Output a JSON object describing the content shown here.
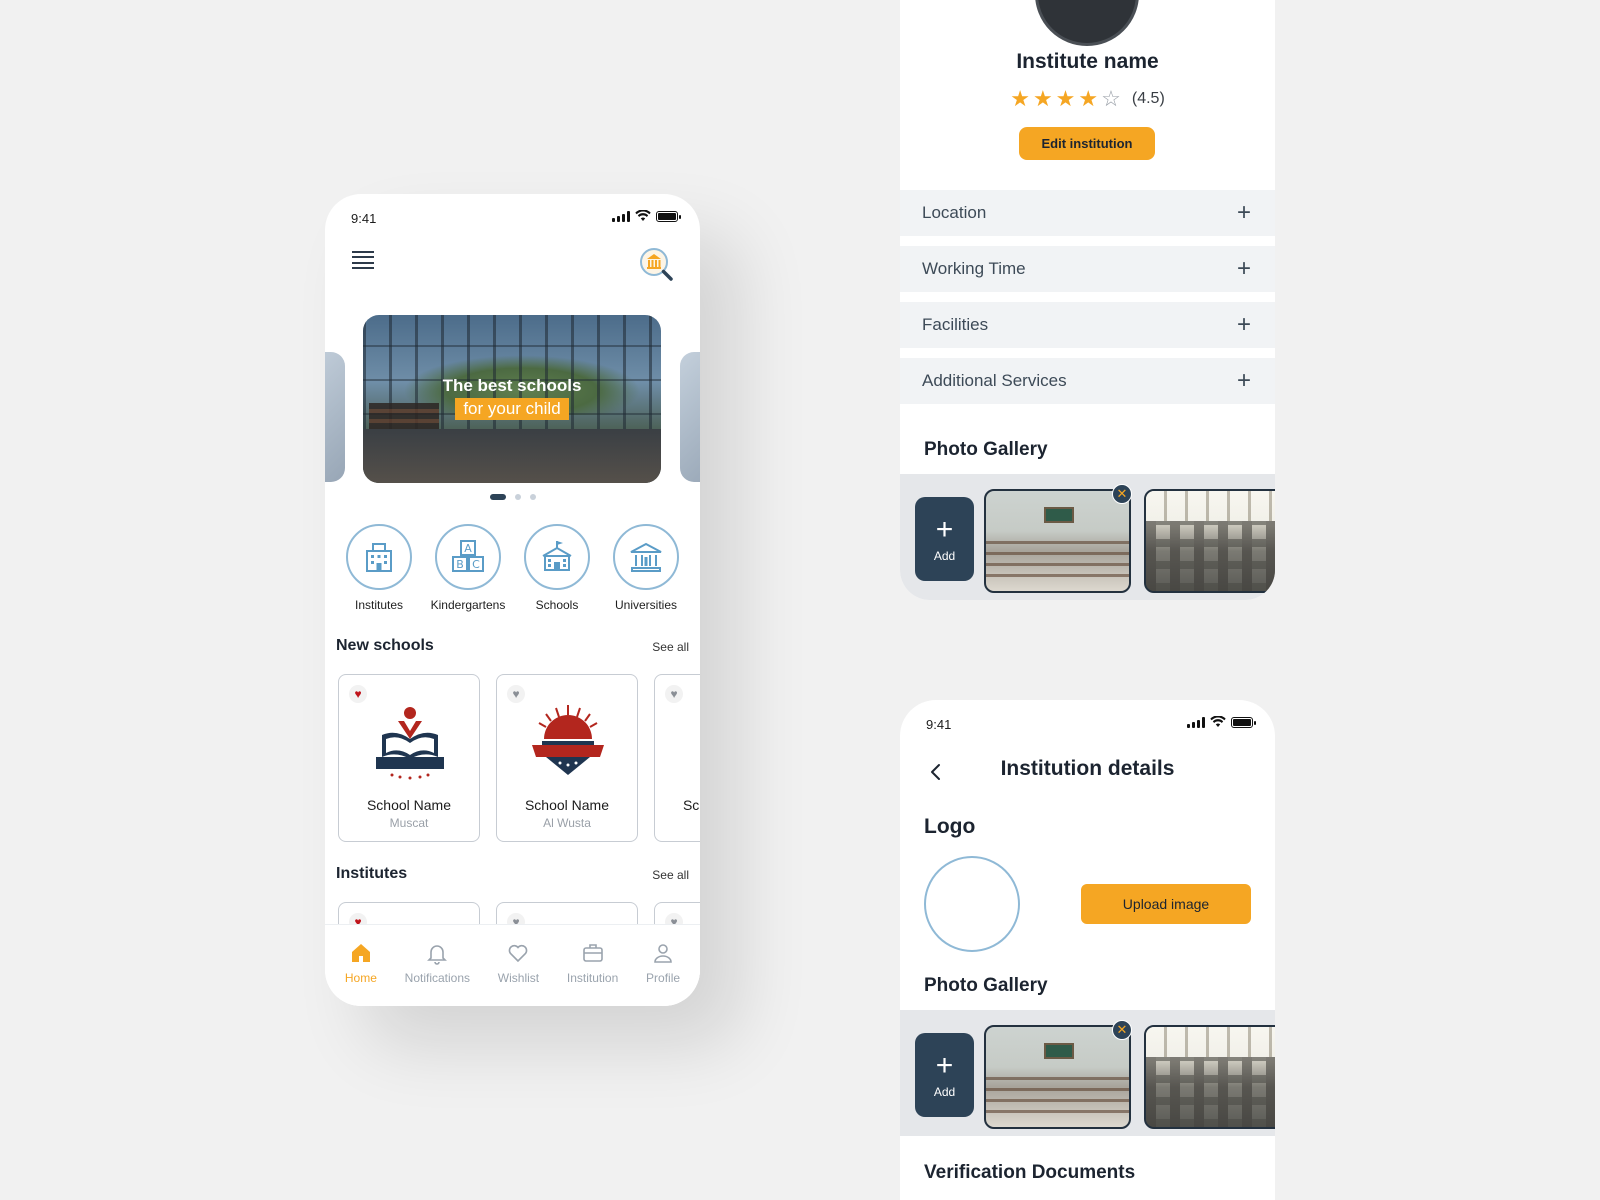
{
  "home": {
    "status_time": "9:41",
    "banner": {
      "line1": "The best schools",
      "line2": "for your child"
    },
    "categories": [
      {
        "label": "Institutes",
        "icon": "building-icon"
      },
      {
        "label": "Kindergartens",
        "icon": "abc-blocks-icon"
      },
      {
        "label": "Schools",
        "icon": "school-icon"
      },
      {
        "label": "Universities",
        "icon": "university-icon"
      }
    ],
    "new_schools": {
      "title": "New schools",
      "see_all": "See all",
      "cards": [
        {
          "name": "School Name",
          "city": "Muscat",
          "favorite": true
        },
        {
          "name": "School Name",
          "city": "Al Wusta",
          "favorite": false
        },
        {
          "name": "School Name",
          "city": "",
          "favorite": false
        }
      ]
    },
    "institutes": {
      "title": "Institutes",
      "see_all": "See all"
    },
    "tabs": [
      {
        "label": "Home",
        "icon": "home-icon",
        "active": true
      },
      {
        "label": "Notifications",
        "icon": "bell-icon",
        "active": false
      },
      {
        "label": "Wishlist",
        "icon": "heart-icon",
        "active": false
      },
      {
        "label": "Institution",
        "icon": "briefcase-icon",
        "active": false
      },
      {
        "label": "Profile",
        "icon": "person-icon",
        "active": false
      }
    ],
    "colors": {
      "accent": "#f5a623",
      "primary": "#2d4357",
      "icon_blue": "#8fb9d6",
      "favorite_red": "#c0141b"
    }
  },
  "institution_profile": {
    "name": "Institute name",
    "rating_value": 4.5,
    "rating_text": "(4.5)",
    "edit_button": "Edit institution",
    "sections": [
      "Location",
      "Working Time",
      "Facilities",
      "Additional Services"
    ],
    "gallery_title": "Photo Gallery",
    "add_label": "Add"
  },
  "institution_details": {
    "status_time": "9:41",
    "title": "Institution details",
    "logo_label": "Logo",
    "upload_button": "Upload image",
    "gallery_title": "Photo Gallery",
    "add_label": "Add",
    "verification_title": "Verification Documents"
  }
}
